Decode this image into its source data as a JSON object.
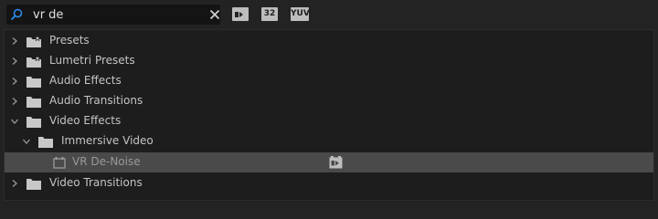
{
  "search": {
    "value": "vr de",
    "placeholder": ""
  },
  "toolbar": {
    "buttons": [
      {
        "name": "accelerated-effects",
        "label": ""
      },
      {
        "name": "32-bit-color",
        "label": "32"
      },
      {
        "name": "yuv-effects",
        "label": "YUV"
      }
    ]
  },
  "tree": [
    {
      "label": "Presets",
      "level": 0,
      "expanded": false,
      "icon": "preset-folder-icon"
    },
    {
      "label": "Lumetri Presets",
      "level": 0,
      "expanded": false,
      "icon": "preset-folder-icon"
    },
    {
      "label": "Audio Effects",
      "level": 0,
      "expanded": false,
      "icon": "folder-icon"
    },
    {
      "label": "Audio Transitions",
      "level": 0,
      "expanded": false,
      "icon": "folder-icon"
    },
    {
      "label": "Video Effects",
      "level": 0,
      "expanded": true,
      "icon": "folder-icon"
    },
    {
      "label": "Immersive Video",
      "level": 1,
      "expanded": true,
      "icon": "folder-icon"
    },
    {
      "label": "VR De-Noise",
      "level": 2,
      "selected": true,
      "icon": "effect-icon",
      "badge": "accelerated-icon"
    },
    {
      "label": "Video Transitions",
      "level": 0,
      "expanded": false,
      "icon": "folder-icon"
    }
  ],
  "colors": {
    "background": "#232323",
    "panel": "#1d1d1d",
    "selected_row": "#4a4a4a",
    "text": "#c4c4c4",
    "accent": "#2d8ceb"
  }
}
